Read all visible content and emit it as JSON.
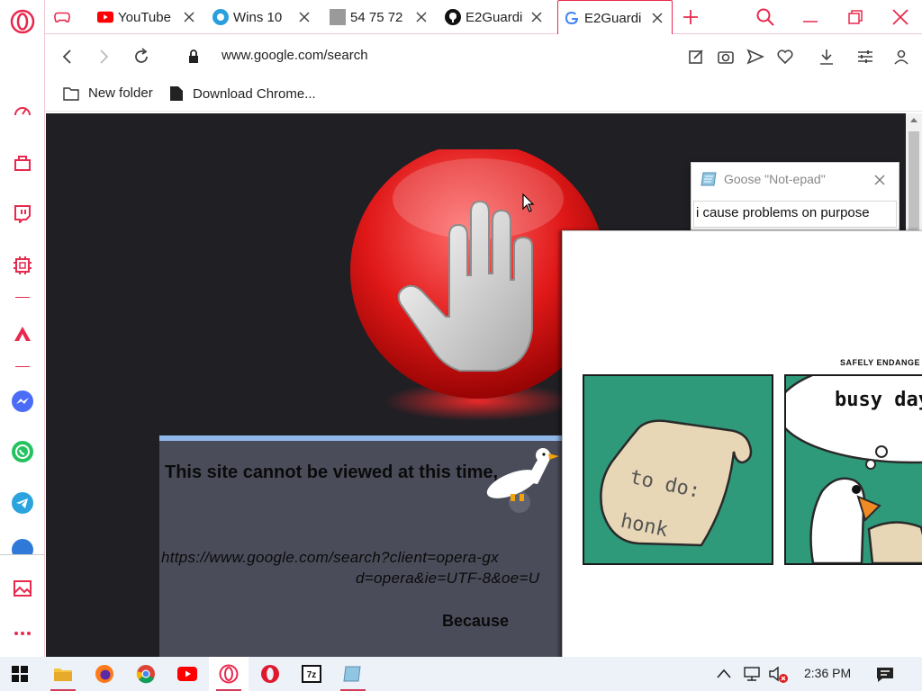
{
  "browser": {
    "tabs": [
      {
        "title": "",
        "icon": "gamepad-icon",
        "active": false
      },
      {
        "title": "YouTube",
        "icon": "youtube-icon",
        "active": false
      },
      {
        "title": "Wins 10",
        "icon": "windows-update-icon",
        "active": false
      },
      {
        "title": "54 75 72",
        "icon": "gray-page-icon",
        "active": false
      },
      {
        "title": "E2Guardi",
        "icon": "github-icon",
        "active": false
      },
      {
        "title": "E2Guardi",
        "icon": "google-icon",
        "active": true
      }
    ],
    "address": {
      "url": "www.google.com/search"
    },
    "bookmarks": [
      {
        "label": "New folder",
        "icon": "folder-icon"
      },
      {
        "label": "Download Chrome...",
        "icon": "file-icon"
      }
    ],
    "accent_color": "#e8294d"
  },
  "blocked_page": {
    "message": "This site cannot be viewed at this time,",
    "url_line1": "https://www.google.com/search?client=opera-gx",
    "url_line2": "d=opera&ie=UTF-8&oe=U",
    "because_label": "Because"
  },
  "notepad_popup": {
    "title": "Goose \"Not-epad\"",
    "text": "i cause problems on purpose"
  },
  "meme": {
    "caption": "SAFELY ENDANGE",
    "panel1_text_line1": "to do:",
    "panel1_text_line2": "honk",
    "panel2_text": "busy day"
  },
  "taskbar": {
    "apps": [
      "file-explorer-icon",
      "firefox-icon",
      "chrome-icon",
      "youtube-app-icon",
      "opera-gx-icon",
      "opera-icon",
      "7zip-icon",
      "notepad-icon"
    ],
    "clock": "2:36 PM"
  }
}
